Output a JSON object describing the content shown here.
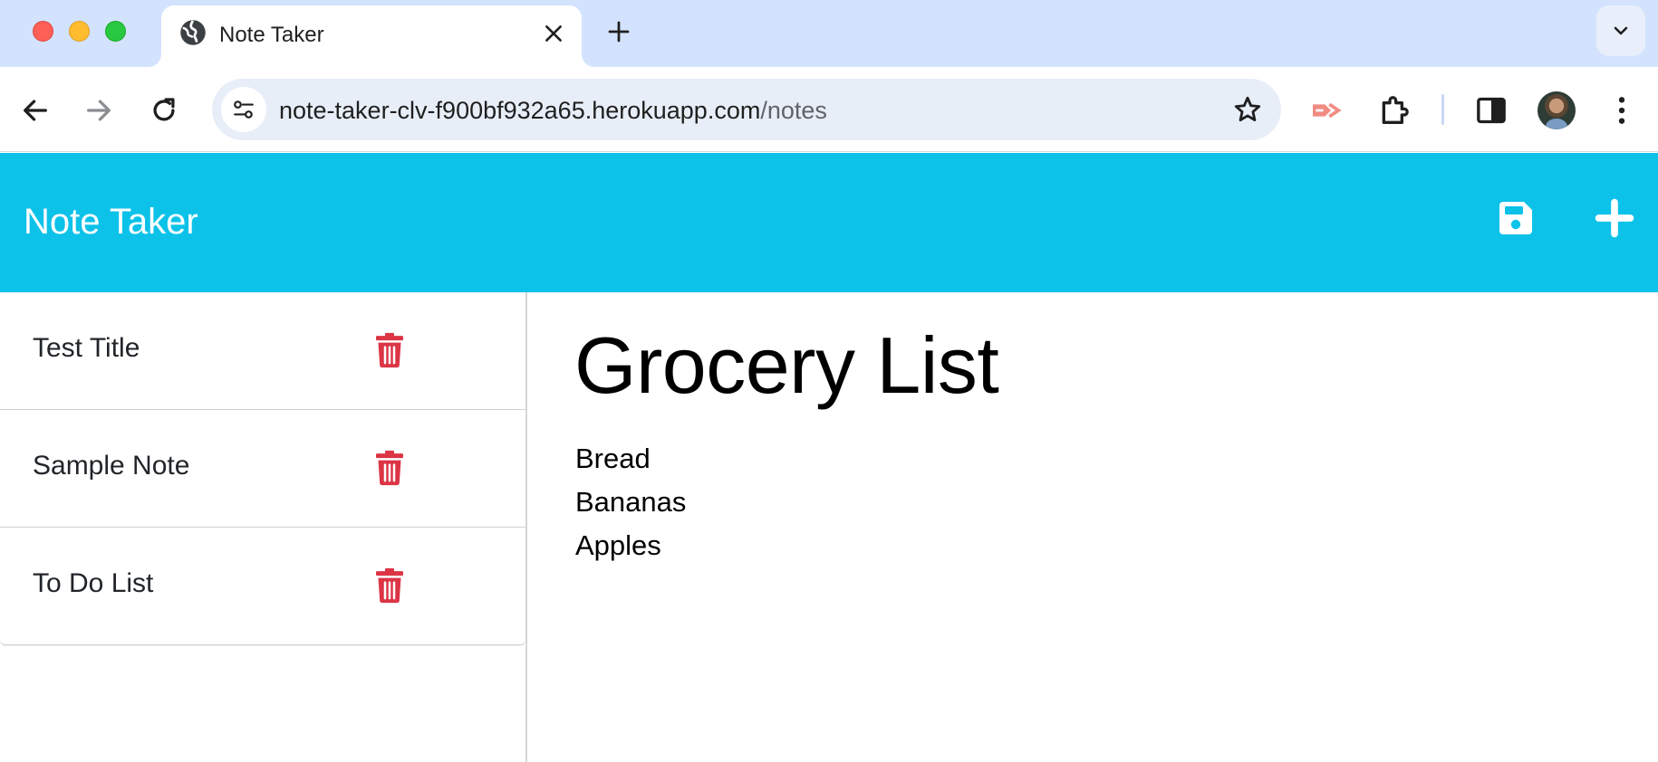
{
  "browser": {
    "tab_title": "Note Taker",
    "url_host": "note-taker-clv-f900bf932a65.herokuapp.com",
    "url_path": "/notes",
    "icons": [
      "globe-icon",
      "close-icon",
      "plus-icon",
      "chevron-down-icon",
      "back-icon",
      "forward-icon",
      "reload-icon",
      "site-settings-icon",
      "star-icon",
      "cast-icon",
      "extensions-icon",
      "side-panel-icon",
      "avatar",
      "more-icon"
    ]
  },
  "app": {
    "brand": "Note Taker",
    "accent_color": "#0dc2e9",
    "delete_color": "#dc3545",
    "notes": [
      {
        "title": "Test Title"
      },
      {
        "title": "Sample Note"
      },
      {
        "title": "To Do List"
      }
    ],
    "active_note": {
      "title": "Grocery List",
      "lines": [
        "Bread",
        "Bananas",
        "Apples"
      ]
    }
  }
}
